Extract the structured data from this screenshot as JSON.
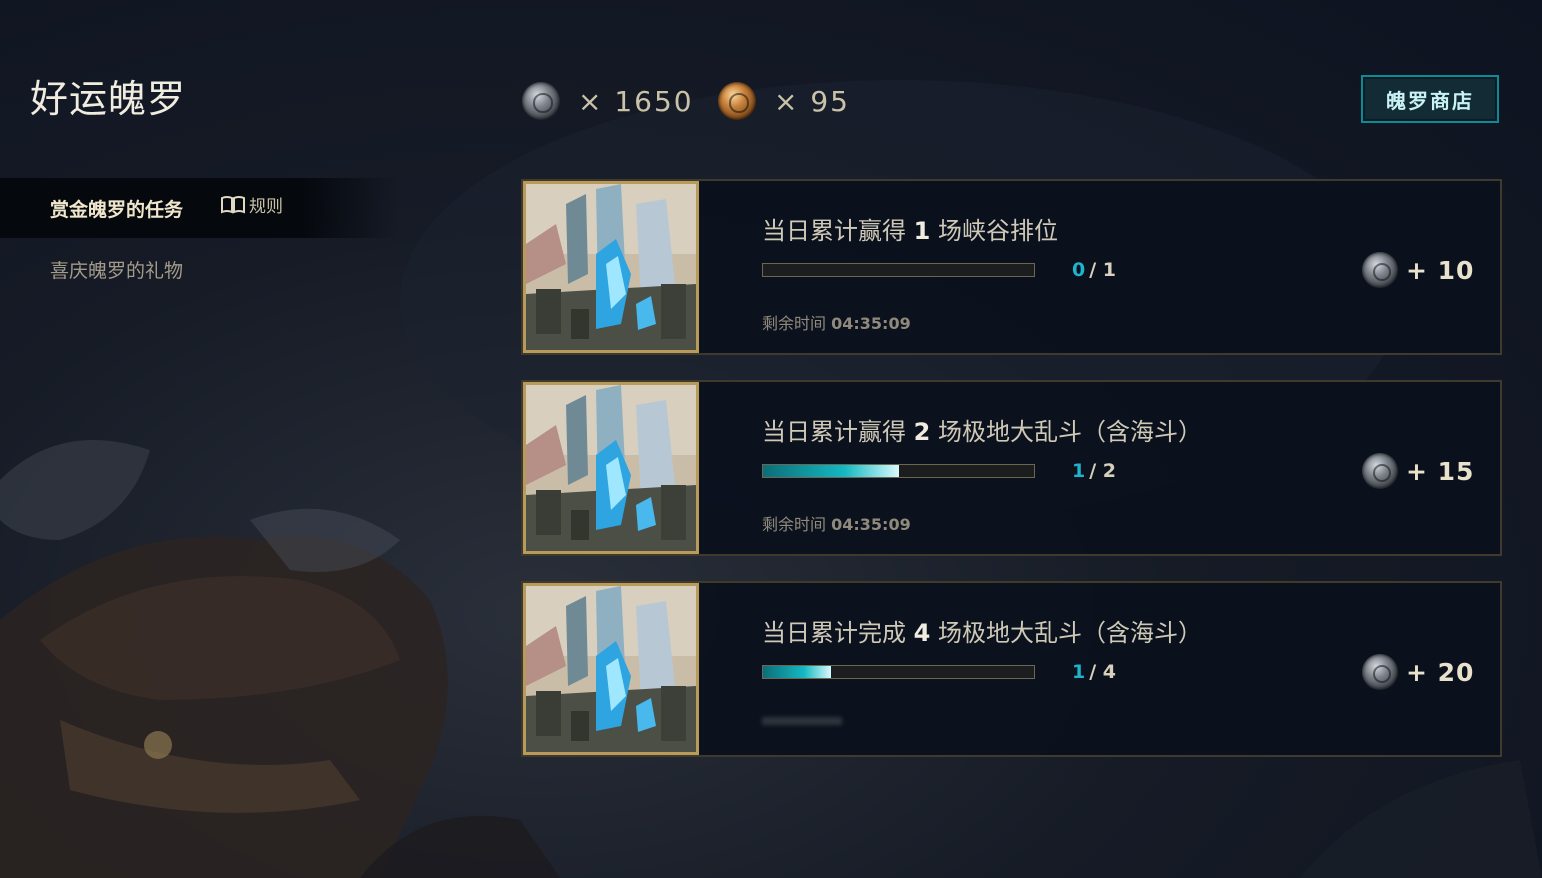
{
  "page": {
    "title": "好运魄罗"
  },
  "currencies": [
    {
      "icon": "silver-poro-coin-icon",
      "value": "× 1650"
    },
    {
      "icon": "gold-poro-coin-icon",
      "value": "× 95"
    }
  ],
  "shop_button": {
    "label": "魄罗商店"
  },
  "sidebar": {
    "active_label": "赏金魄罗的任务",
    "rules_label": "规则",
    "items": [
      {
        "label": "喜庆魄罗的礼物"
      }
    ]
  },
  "quests": [
    {
      "title_prefix": "当日累计赢得",
      "count": "1",
      "title_suffix": "场峡谷排位",
      "progress_current": "0",
      "progress_total": "/ 1",
      "progress_fraction": 0,
      "time_label": "剩余时间",
      "time_value": "04:35:09",
      "reward": "+ 10"
    },
    {
      "title_prefix": "当日累计赢得",
      "count": "2",
      "title_suffix": "场极地大乱斗（含海斗）",
      "progress_current": "1",
      "progress_total": "/ 2",
      "progress_fraction": 0.5,
      "time_label": "剩余时间",
      "time_value": "04:35:09",
      "reward": "+ 15"
    },
    {
      "title_prefix": "当日累计完成",
      "count": "4",
      "title_suffix": "场极地大乱斗（含海斗）",
      "progress_current": "1",
      "progress_total": "/ 4",
      "progress_fraction": 0.25,
      "reward": "+ 20"
    }
  ],
  "colors": {
    "accent_teal": "#0e8a94",
    "progress_number": "#1fb3cc",
    "card_border": "#3f3a2c",
    "thumb_border": "#b89a5a"
  }
}
